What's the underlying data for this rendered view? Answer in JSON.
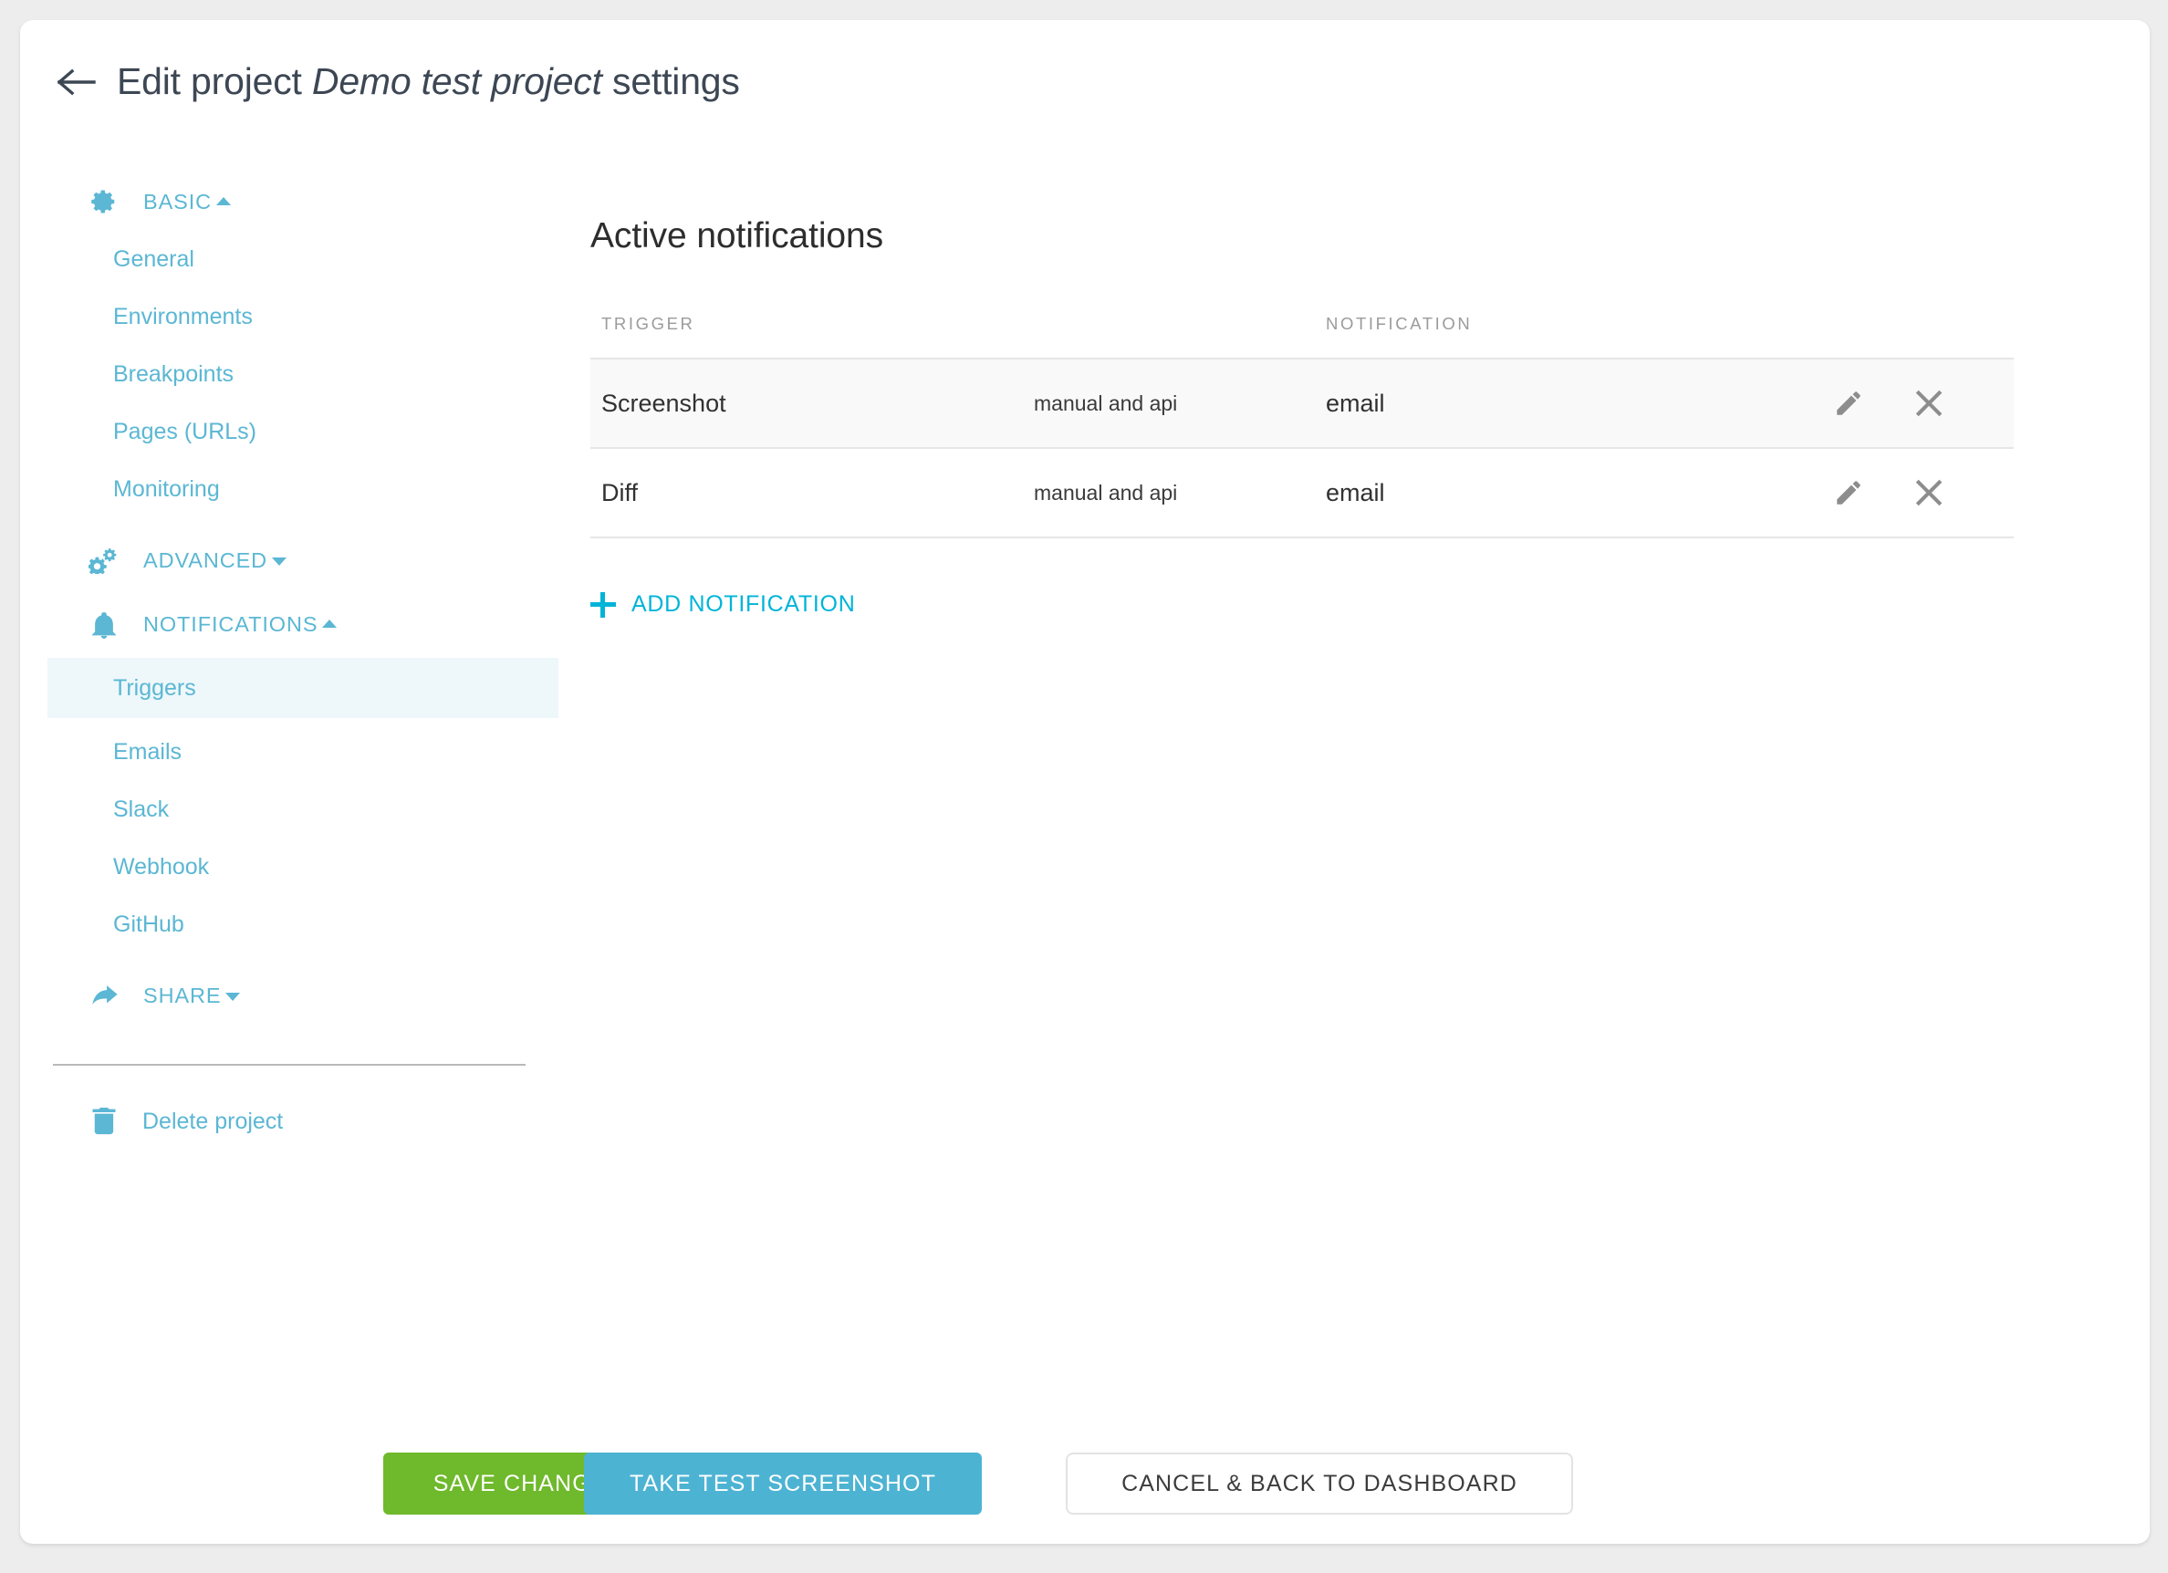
{
  "header": {
    "back_icon": "arrow-left-icon",
    "title_prefix": "Edit project",
    "project_name": "Demo test project",
    "title_suffix": "settings"
  },
  "sidebar": {
    "groups": [
      {
        "label": "BASIC",
        "icon": "gear-icon",
        "expanded": true,
        "caret": "caret-up",
        "items": [
          {
            "label": "General"
          },
          {
            "label": "Environments"
          },
          {
            "label": "Breakpoints"
          },
          {
            "label": "Pages (URLs)"
          },
          {
            "label": "Monitoring"
          }
        ]
      },
      {
        "label": "ADVANCED",
        "icon": "gears-icon",
        "expanded": false,
        "caret": "caret-down",
        "items": []
      },
      {
        "label": "NOTIFICATIONS",
        "icon": "bell-icon",
        "expanded": true,
        "caret": "caret-up",
        "items": [
          {
            "label": "Triggers",
            "active": true
          },
          {
            "label": "Emails"
          },
          {
            "label": "Slack"
          },
          {
            "label": "Webhook"
          },
          {
            "label": "GitHub"
          }
        ]
      },
      {
        "label": "SHARE",
        "icon": "share-arrow-icon",
        "expanded": false,
        "caret": "caret-down",
        "items": []
      }
    ],
    "delete": {
      "label": "Delete project",
      "icon": "trash-icon"
    }
  },
  "main": {
    "section_title": "Active notifications",
    "table": {
      "columns": [
        "TRIGGER",
        "NOTIFICATION"
      ],
      "rows": [
        {
          "trigger": "Screenshot",
          "mode": "manual and api",
          "notification": "email",
          "edit_icon": "pencil-icon",
          "delete_icon": "close-icon"
        },
        {
          "trigger": "Diff",
          "mode": "manual and api",
          "notification": "email",
          "edit_icon": "pencil-icon",
          "delete_icon": "close-icon"
        }
      ]
    },
    "add_notification": {
      "label": "ADD NOTIFICATION",
      "icon": "plus-icon"
    }
  },
  "footer": {
    "save_label": "SAVE CHANGES",
    "test_label": "TAKE TEST SCREENSHOT",
    "cancel_label": "CANCEL & BACK TO DASHBOARD"
  },
  "colors": {
    "accent": "#5bb7d4",
    "link_bright": "#00b4d8",
    "save_green": "#6fb92c",
    "test_blue": "#4db3d3",
    "active_bg": "#eef7fa",
    "page_bg": "#ededed"
  }
}
